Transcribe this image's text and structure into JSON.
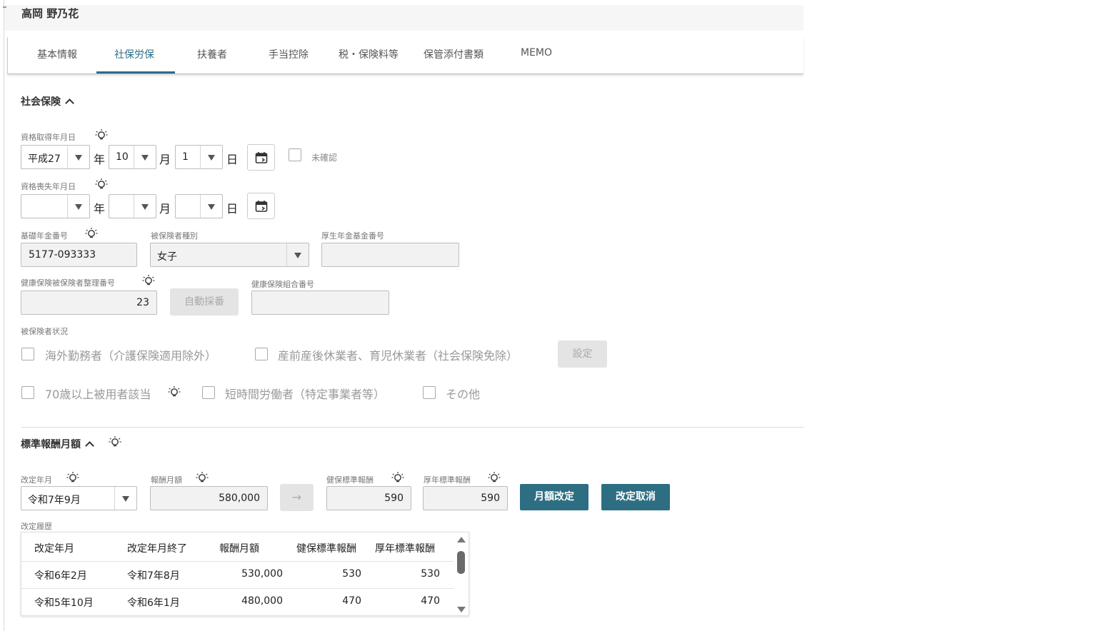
{
  "employee": {
    "name": "高岡 野乃花"
  },
  "tabs": [
    {
      "label": "基本情報"
    },
    {
      "label": "社保労保"
    },
    {
      "label": "扶養者"
    },
    {
      "label": "手当控除"
    },
    {
      "label": "税・保険料等"
    },
    {
      "label": "保管添付書類"
    },
    {
      "label": "MEMO"
    }
  ],
  "active_tab": "社保労保",
  "social_insurance": {
    "title": "社会保険",
    "acquisition": {
      "label": "資格取得年月日",
      "era": "平成27",
      "year_unit": "年",
      "month": "10",
      "month_unit": "月",
      "day": "1",
      "day_unit": "日",
      "unconfirmed_label": "未確認"
    },
    "loss": {
      "label": "資格喪失年月日",
      "era": "",
      "year_unit": "年",
      "month": "",
      "month_unit": "月",
      "day": "",
      "day_unit": "日"
    },
    "pension_number": {
      "label": "基礎年金番号",
      "value": "5177-093333"
    },
    "insured_type": {
      "label": "被保険者種別",
      "value": "女子"
    },
    "welfare_fund_number": {
      "label": "厚生年金基金番号",
      "value": ""
    },
    "health_insured_number": {
      "label": "健康保険被保険者整理番号",
      "value": "23",
      "auto_button": "自動採番"
    },
    "union_number": {
      "label": "健康保険組合番号",
      "value": ""
    },
    "status": {
      "label": "被保険者状況",
      "options": [
        {
          "label": "海外勤務者（介護保険適用除外）"
        },
        {
          "label": "産前産後休業者、育児休業者（社会保険免除）"
        },
        {
          "label": "70歳以上被用者該当"
        },
        {
          "label": "短時間労働者（特定事業者等）"
        },
        {
          "label": "その他"
        }
      ],
      "settings_button": "設定"
    }
  },
  "standard_remuneration": {
    "title": "標準報酬月額",
    "revision_ym": {
      "label": "改定年月",
      "value": "令和7年9月"
    },
    "monthly": {
      "label": "報酬月額",
      "value": "580,000"
    },
    "arrow_button": "→",
    "health_std": {
      "label": "健保標準報酬",
      "value": "590"
    },
    "pension_std": {
      "label": "厚年標準報酬",
      "value": "590"
    },
    "revise_button": "月額改定",
    "cancel_button": "改定取消",
    "history": {
      "label": "改定履歴",
      "columns": [
        "改定年月",
        "改定年月終了",
        "報酬月額",
        "健保標準報酬",
        "厚年標準報酬"
      ],
      "rows": [
        [
          "令和6年2月",
          "令和7年8月",
          "530,000",
          "530",
          "530"
        ],
        [
          "令和5年10月",
          "令和6年1月",
          "480,000",
          "470",
          "470"
        ]
      ]
    }
  },
  "colors": {
    "accent": "#2e6e83",
    "tab_active": "#2a6f86"
  }
}
